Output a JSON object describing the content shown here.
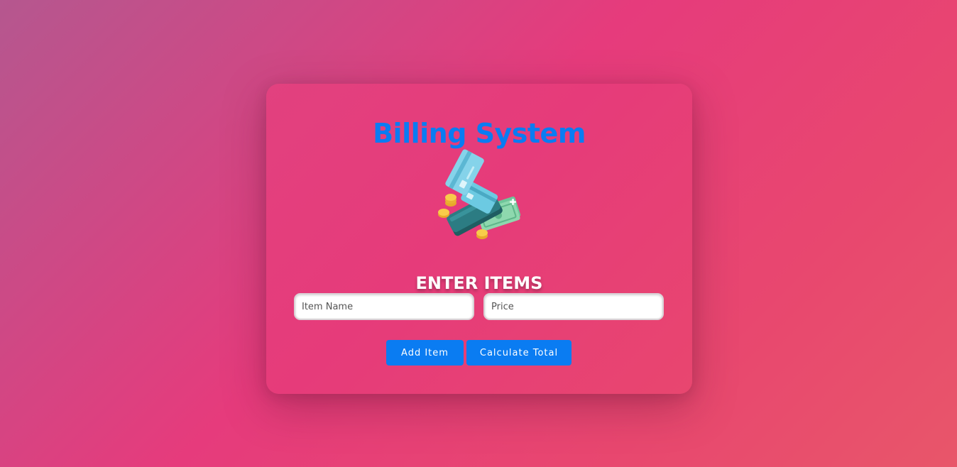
{
  "app": {
    "title": "Billing System",
    "section_heading": "ENTER ITEMS",
    "illustration_icon": "payment-card-wallet-icon"
  },
  "form": {
    "item_name_placeholder": "Item Name",
    "price_placeholder": "Price",
    "item_name_value": "",
    "price_value": ""
  },
  "buttons": {
    "add_item_label": "Add Item",
    "calculate_total_label": "Calculate Total"
  },
  "colors": {
    "accent": "#0a7cf2",
    "background": "#e63b7c",
    "card": "#e2417f"
  }
}
